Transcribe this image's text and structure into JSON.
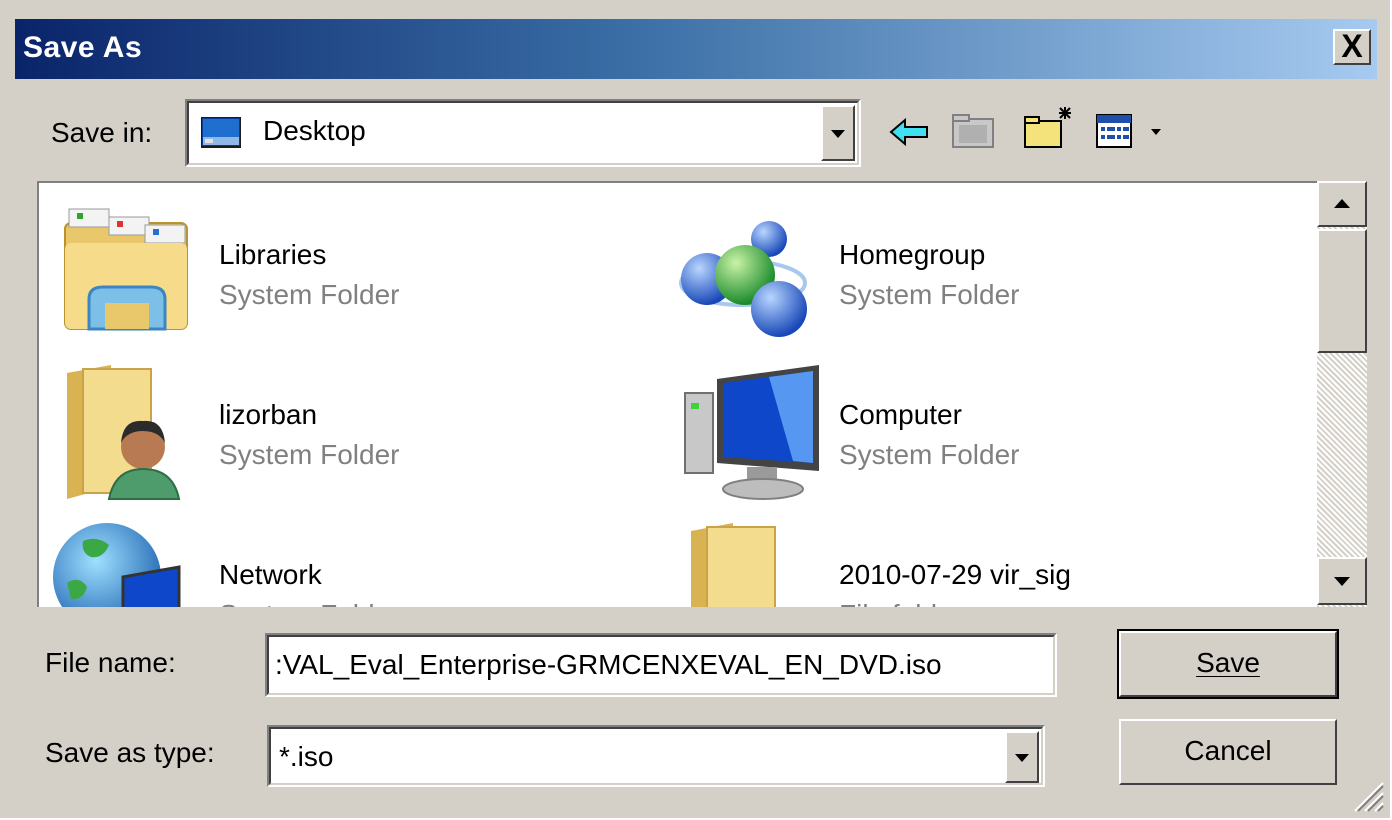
{
  "window": {
    "title": "Save As",
    "close_symbol": "X"
  },
  "save_in": {
    "label": "Save in:",
    "value": "Desktop"
  },
  "toolbar": {
    "icons": [
      "back-arrow-icon",
      "up-folder-icon",
      "new-folder-icon",
      "view-menu-icon"
    ]
  },
  "files": [
    {
      "name": "Libraries",
      "type": "System Folder",
      "icon": "libraries-icon"
    },
    {
      "name": "Homegroup",
      "type": "System Folder",
      "icon": "homegroup-icon"
    },
    {
      "name": "lizorban",
      "type": "System Folder",
      "icon": "user-folder-icon"
    },
    {
      "name": "Computer",
      "type": "System Folder",
      "icon": "computer-icon"
    },
    {
      "name": "Network",
      "type": "System Folder",
      "icon": "network-icon"
    },
    {
      "name": "2010-07-29 vir_sig",
      "type": "File folder",
      "icon": "folder-icon"
    }
  ],
  "file_name": {
    "label": "File name:",
    "value": ":VAL_Eval_Enterprise-GRMCENXEVAL_EN_DVD.iso"
  },
  "save_as_type": {
    "label": "Save as type:",
    "value": "*.iso"
  },
  "buttons": {
    "save": "Save",
    "cancel": "Cancel"
  },
  "colors": {
    "title_start": "#0a246a",
    "title_end": "#a6caf0",
    "face": "#d4d0c8"
  }
}
